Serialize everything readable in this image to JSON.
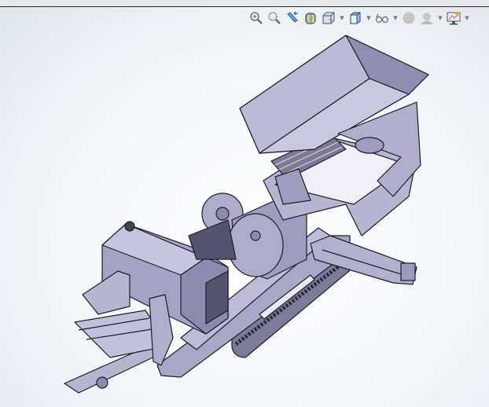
{
  "toolbar": {
    "icons": [
      "zoom-to-fit-icon",
      "zoom-to-area-icon",
      "previous-view-icon",
      "section-view-icon",
      "view-orientation-icon",
      "display-style-icon",
      "hide-show-items-icon",
      "edit-appearance-icon",
      "apply-scene-icon",
      "view-settings-icon"
    ]
  },
  "model": {
    "fill": "#a9a7c6",
    "edge": "#1d1d2b",
    "shade": "#8d8aae",
    "light": "#c9c8de"
  }
}
